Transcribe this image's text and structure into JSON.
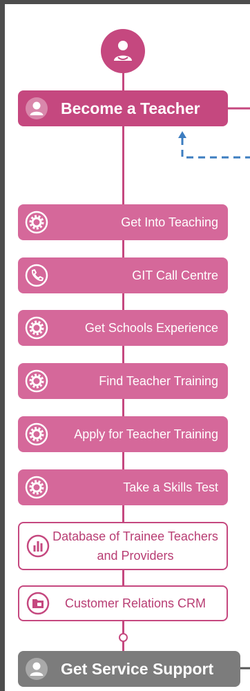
{
  "header": {
    "label": "Become a Teacher",
    "icon": "user-icon"
  },
  "services": [
    {
      "label": "Get Into Teaching",
      "icon": "gear-icon"
    },
    {
      "label": "GIT Call Centre",
      "icon": "phone-icon"
    },
    {
      "label": "Get Schools Experience",
      "icon": "gear-icon"
    },
    {
      "label": "Find Teacher Training",
      "icon": "gear-icon"
    },
    {
      "label": "Apply for Teacher Training",
      "icon": "gear-icon"
    },
    {
      "label": "Take a Skills Test",
      "icon": "gear-icon"
    }
  ],
  "data_nodes": [
    {
      "label": "Database of Trainee Teachers and Providers",
      "icon": "bar-chart-icon"
    },
    {
      "label": "Customer Relations CRM",
      "icon": "folder-icon"
    }
  ],
  "footer": {
    "label": "Get Service Support",
    "icon": "user-icon"
  },
  "colors": {
    "accent": "#c5487f",
    "service_fill": "#d5689a",
    "support_grey": "#7c7c7c",
    "connector_blue": "#3c7dc0",
    "frame": "#4d4d4d"
  }
}
